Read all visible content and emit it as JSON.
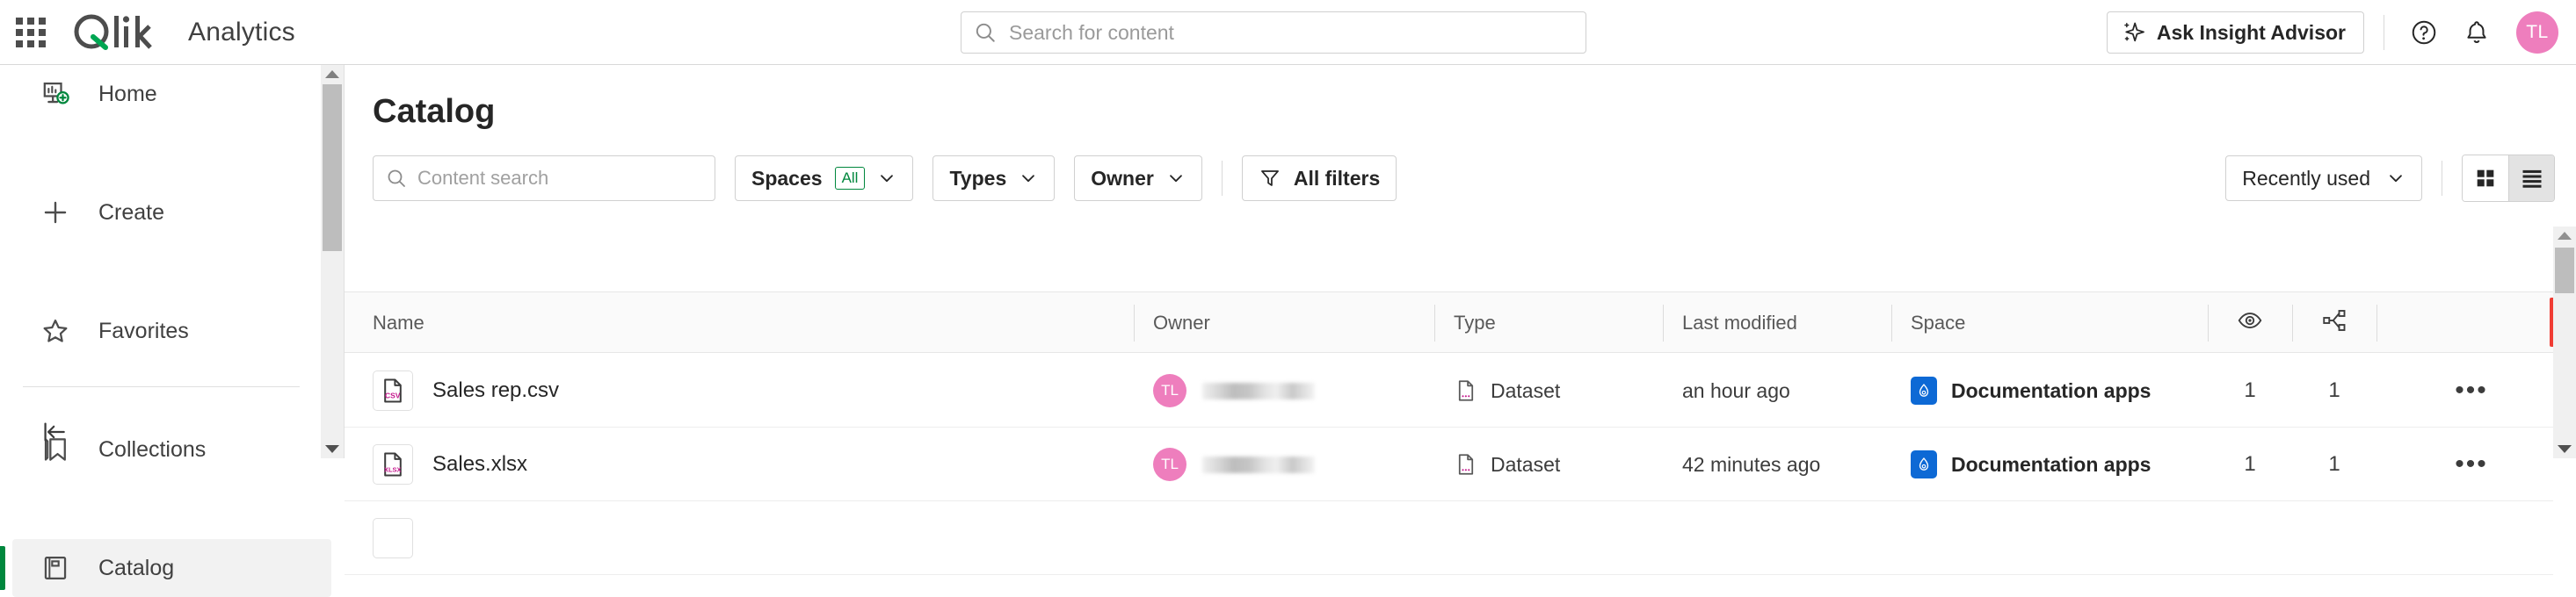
{
  "header": {
    "app_menu_icon": "waffle-grid-icon",
    "brand": "Qlik",
    "product": "Analytics",
    "search": {
      "placeholder": "Search for content",
      "value": "",
      "icon": "search-icon"
    },
    "insight_advisor_label": "Ask Insight Advisor",
    "insight_icon": "sparkle-icon",
    "help_icon": "help-circle-icon",
    "notifications_icon": "bell-icon",
    "avatar_initials": "TL",
    "avatar_color": "#ee7ebd"
  },
  "sidebar": {
    "items": [
      {
        "label": "Home",
        "icon": "home-chart-icon",
        "active": false
      },
      {
        "label": "Create",
        "icon": "plus-icon",
        "active": false
      },
      {
        "label": "Favorites",
        "icon": "star-icon",
        "active": false
      },
      {
        "label": "Collections",
        "icon": "bookmark-icon",
        "active": false
      },
      {
        "label": "Catalog",
        "icon": "catalog-book-icon",
        "active": true
      }
    ],
    "collapse_icon": "collapse-left-icon",
    "active_accent": "#00873d"
  },
  "main": {
    "title": "Catalog",
    "content_search": {
      "placeholder": "Content search",
      "value": "",
      "icon": "search-icon"
    },
    "filters": [
      {
        "label": "Spaces",
        "badge": "All",
        "icon": "chevron-down-icon"
      },
      {
        "label": "Types",
        "badge": "",
        "icon": "chevron-down-icon"
      },
      {
        "label": "Owner",
        "badge": "",
        "icon": "chevron-down-icon"
      }
    ],
    "all_filters_label": "All filters",
    "all_filters_icon": "funnel-icon",
    "sort": {
      "label": "Recently used",
      "icon": "chevron-down-icon"
    },
    "view_toggle": [
      {
        "name": "grid-view",
        "icon": "grid-view-icon",
        "selected": false
      },
      {
        "name": "list-view",
        "icon": "list-view-icon",
        "selected": true
      }
    ],
    "highlight_color": "#f03c33"
  },
  "table": {
    "columns": [
      {
        "key": "name",
        "label": "Name"
      },
      {
        "key": "owner",
        "label": "Owner"
      },
      {
        "key": "type",
        "label": "Type"
      },
      {
        "key": "modified",
        "label": "Last modified"
      },
      {
        "key": "space",
        "label": "Space"
      },
      {
        "key": "views",
        "label": "",
        "icon": "eye-icon"
      },
      {
        "key": "lineage",
        "label": "",
        "icon": "lineage-icon"
      }
    ],
    "rows": [
      {
        "name": "Sales rep.csv",
        "file_icon": "csv-file-icon",
        "file_ext": "CSV",
        "owner_initials": "TL",
        "owner_name_redacted": true,
        "type": "Dataset",
        "type_icon": "dataset-file-icon",
        "modified": "an hour ago",
        "space": "Documentation apps",
        "space_icon": "shared-space-icon",
        "views": "1",
        "lineage": "1",
        "menu_icon": "kebab-menu-icon",
        "menu_label": "•••"
      },
      {
        "name": "Sales.xlsx",
        "file_icon": "xlsx-file-icon",
        "file_ext": "XLSX",
        "owner_initials": "TL",
        "owner_name_redacted": true,
        "type": "Dataset",
        "type_icon": "dataset-file-icon",
        "modified": "42 minutes ago",
        "space": "Documentation apps",
        "space_icon": "shared-space-icon",
        "views": "1",
        "lineage": "1",
        "menu_icon": "kebab-menu-icon",
        "menu_label": "•••"
      }
    ]
  }
}
